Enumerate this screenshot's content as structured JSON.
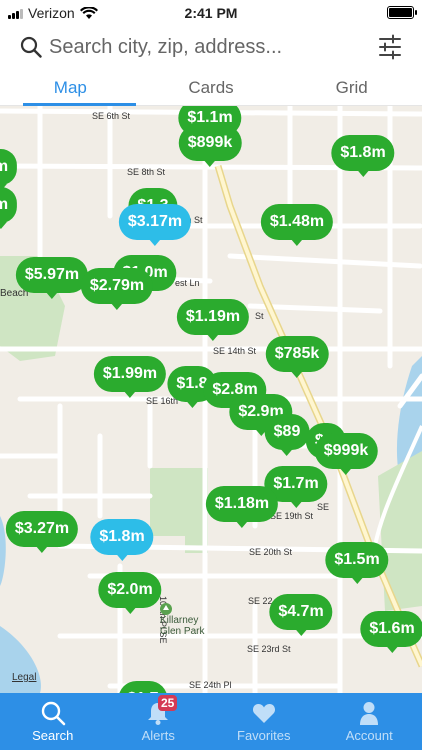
{
  "status_bar": {
    "carrier": "Verizon",
    "time": "2:41 PM"
  },
  "search": {
    "placeholder": "Search city, zip, address..."
  },
  "tabs": [
    {
      "label": "Map",
      "active": true
    },
    {
      "label": "Cards",
      "active": false
    },
    {
      "label": "Grid",
      "active": false
    }
  ],
  "map": {
    "streets": [
      "SE 6th St",
      "SE 8th St",
      "SE 14th St",
      "SE 16th",
      "SE 19th St",
      "SE 20th St",
      "SE 22",
      "SE 23rd St",
      "SE 24th Pl",
      "104th Pl SE",
      "SE",
      "St",
      "th St",
      "est Ln",
      "Beach",
      "St"
    ],
    "park_label": "Killarney Glen Park",
    "legal": "Legal",
    "pins": [
      {
        "price": "$1.1m",
        "selected": false
      },
      {
        "price": "$899k",
        "selected": false
      },
      {
        "price": "$1.8m",
        "selected": false
      },
      {
        "price": "m",
        "selected": false
      },
      {
        "price": "m",
        "selected": false
      },
      {
        "price": "$1.3",
        "selected": false
      },
      {
        "price": "$3.17m",
        "selected": true
      },
      {
        "price": "$1.48m",
        "selected": false
      },
      {
        "price": "$5.97m",
        "selected": false
      },
      {
        "price": "$1.0m",
        "selected": false
      },
      {
        "price": "$2.79m",
        "selected": false
      },
      {
        "price": "$1.19m",
        "selected": false
      },
      {
        "price": "$785k",
        "selected": false
      },
      {
        "price": "$1.99m",
        "selected": false
      },
      {
        "price": "$1.8",
        "selected": false
      },
      {
        "price": "$2.8m",
        "selected": false
      },
      {
        "price": "$2.9m",
        "selected": false
      },
      {
        "price": "$89",
        "selected": false
      },
      {
        "price": "$1.",
        "selected": false
      },
      {
        "price": "$999k",
        "selected": false
      },
      {
        "price": "$1.7m",
        "selected": false
      },
      {
        "price": "$1.18m",
        "selected": false
      },
      {
        "price": "$3.27m",
        "selected": false
      },
      {
        "price": "$1.8m",
        "selected": true
      },
      {
        "price": "$1.5m",
        "selected": false
      },
      {
        "price": "$2.0m",
        "selected": false
      },
      {
        "price": "$4.7m",
        "selected": false
      },
      {
        "price": "$1.6m",
        "selected": false
      },
      {
        "price": "$1.7",
        "selected": false
      }
    ]
  },
  "nav": [
    {
      "label": "Search",
      "icon": "search-icon",
      "active": true
    },
    {
      "label": "Alerts",
      "icon": "bell-icon",
      "active": false,
      "badge": "25"
    },
    {
      "label": "Favorites",
      "icon": "heart-icon",
      "active": false
    },
    {
      "label": "Account",
      "icon": "person-icon",
      "active": false
    }
  ],
  "colors": {
    "accent": "#2d8fe6",
    "pin": "#2bab2e",
    "pin_selected": "#2dbde8",
    "badge": "#d43a55"
  }
}
